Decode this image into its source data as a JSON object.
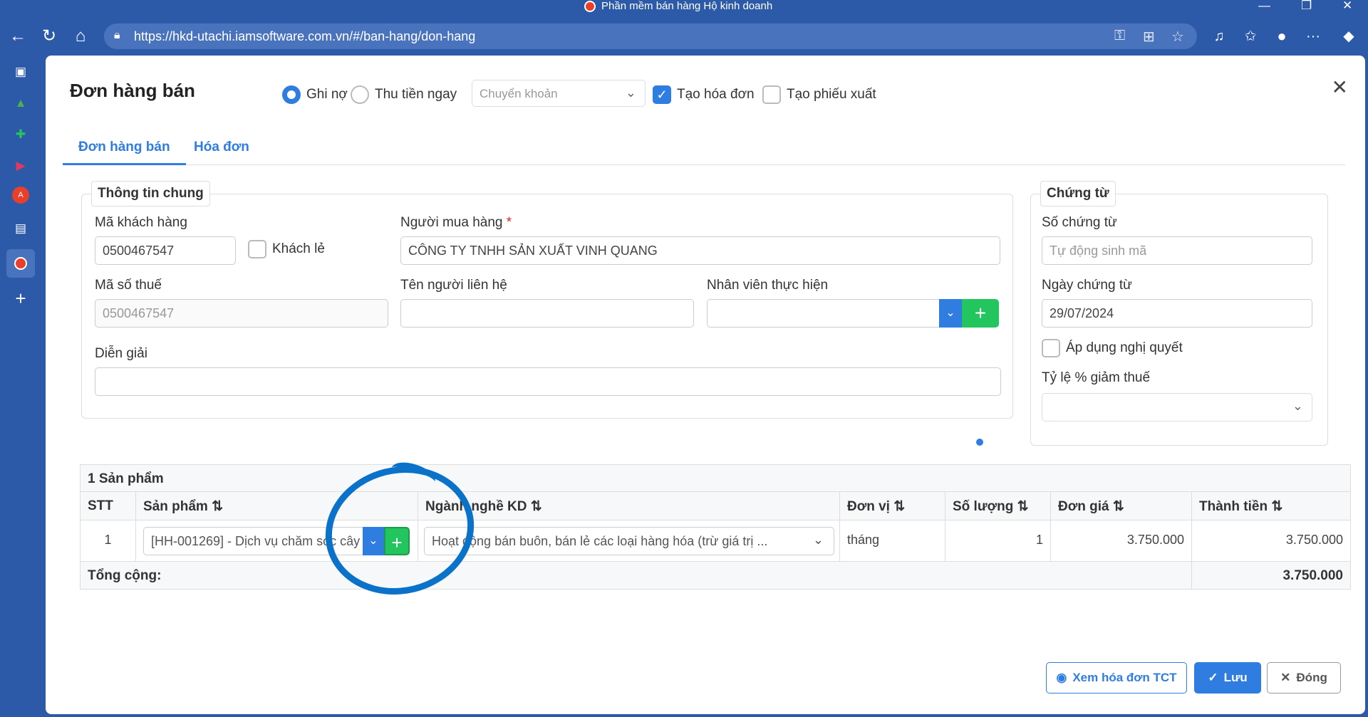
{
  "browser": {
    "window_title": "Phần mềm bán hàng Hộ kinh doanh",
    "url": "https://hkd-utachi.iamsoftware.com.vn/#/ban-hang/don-hang"
  },
  "dialog": {
    "title": "Đơn hàng bán",
    "payment": {
      "ghi_no": "Ghi nợ",
      "thu_tien_ngay": "Thu tiền ngay",
      "method_placeholder": "Chuyển khoản",
      "tao_hoa_don": "Tạo hóa đơn",
      "tao_phieu_xuat": "Tạo phiếu xuất"
    },
    "tabs": [
      "Đơn hàng bán",
      "Hóa đơn"
    ]
  },
  "general": {
    "legend": "Thông tin chung",
    "ma_khach_hang_label": "Mã khách hàng",
    "ma_khach_hang_value": "0500467547",
    "khach_le_label": "Khách lẻ",
    "nguoi_mua_label": "Người mua hàng",
    "required_mark": "*",
    "nguoi_mua_value": "CÔNG TY TNHH SẢN XUẤT VINH QUANG",
    "ma_so_thue_label": "Mã số thuế",
    "ma_so_thue_value": "0500467547",
    "ten_lien_he_label": "Tên người liên hệ",
    "ten_lien_he_value": "",
    "nhan_vien_label": "Nhân viên thực hiện",
    "nhan_vien_value": "",
    "dien_giai_label": "Diễn giải",
    "dien_giai_value": ""
  },
  "voucher": {
    "legend": "Chứng từ",
    "so_chung_tu_label": "Số chứng từ",
    "so_chung_tu_placeholder": "Tự động sinh mã",
    "ngay_chung_tu_label": "Ngày chứng từ",
    "ngay_chung_tu_value": "29/07/2024",
    "ap_dung_label": "Áp dụng nghị quyết",
    "ty_le_label": "Tỷ lệ % giảm thuế",
    "ty_le_value": ""
  },
  "products": {
    "caption": "1 Sản phẩm",
    "headers": [
      "STT",
      "Sản phẩm",
      "Ngành nghề KD",
      "Đơn vị",
      "Số lượng",
      "Đơn giá",
      "Thành tiền"
    ],
    "sort_icon": "⇅",
    "rows": [
      {
        "stt": "1",
        "san_pham": "[HH-001269] - Dịch vụ chăm sóc cây",
        "nganh_nghe": "Hoạt động bán buôn, bán lẻ các loại hàng hóa (trừ giá trị ...",
        "don_vi": "tháng",
        "so_luong": "1",
        "don_gia": "3.750.000",
        "thanh_tien": "3.750.000"
      }
    ],
    "total_label": "Tổng cộng:",
    "total_value": "3.750.000"
  },
  "footer": {
    "view_invoice": "Xem hóa đơn TCT",
    "save": "Lưu",
    "close": "Đóng"
  },
  "colors": {
    "accent": "#2f7de0",
    "add": "#22c55e",
    "annotation": "#0a72c9",
    "chrome": "#2d5aa8"
  }
}
